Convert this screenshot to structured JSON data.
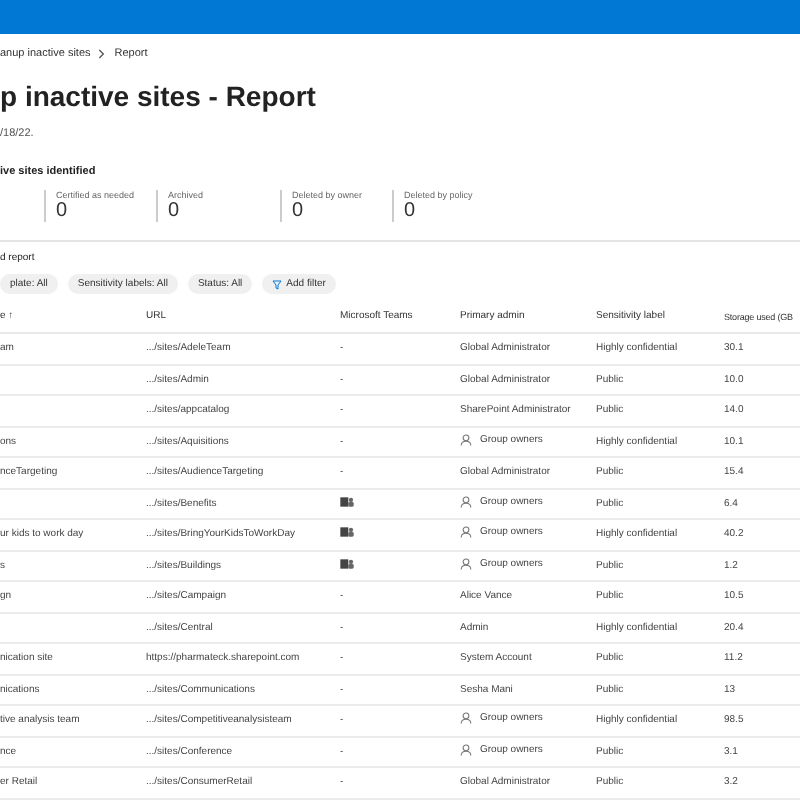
{
  "breadcrumb": [
    "anup inactive sites",
    "Report"
  ],
  "title": "p inactive sites - Report",
  "date": "/18/22.",
  "summary": {
    "heading": "ive sites identified",
    "stats": [
      {
        "label": "Certified as needed",
        "value": "0"
      },
      {
        "label": "Archived",
        "value": "0"
      },
      {
        "label": "Deleted by owner",
        "value": "0"
      },
      {
        "label": "Deleted by policy",
        "value": "0"
      }
    ]
  },
  "section_title": "d report",
  "filters": [
    {
      "label": "plate: All",
      "kind": "pill"
    },
    {
      "label": "Sensitivity labels: All",
      "kind": "pill"
    },
    {
      "label": "Status: All",
      "kind": "pill"
    },
    {
      "label": "Add filter",
      "kind": "add"
    }
  ],
  "table": {
    "columns": [
      "e ↑",
      "URL",
      "Microsoft Teams",
      "Primary admin",
      "Sensitivity label",
      "Storage used (GB"
    ],
    "rows": [
      {
        "name": "am",
        "url": ".../sites/AdeleTeam",
        "teams": false,
        "teams_text": "-",
        "admin": "Global Administrator",
        "group": false,
        "label": "Highly confidential",
        "storage": "30.1"
      },
      {
        "name": "",
        "url": ".../sites/Admin",
        "teams": false,
        "teams_text": "-",
        "admin": "Global Administrator",
        "group": false,
        "label": "Public",
        "storage": "10.0"
      },
      {
        "name": "",
        "url": ".../sites/appcatalog",
        "teams": false,
        "teams_text": "-",
        "admin": "SharePoint Administrator",
        "group": false,
        "label": "Public",
        "storage": "14.0"
      },
      {
        "name": "ons",
        "url": ".../sites/Aquisitions",
        "teams": false,
        "teams_text": "-",
        "admin": "Group owners",
        "group": true,
        "label": "Highly confidential",
        "storage": "10.1"
      },
      {
        "name": "nceTargeting",
        "url": ".../sites/AudienceTargeting",
        "teams": false,
        "teams_text": "-",
        "admin": "Global Administrator",
        "group": false,
        "label": "Public",
        "storage": "15.4"
      },
      {
        "name": "",
        "url": ".../sites/Benefits",
        "teams": true,
        "admin": "Group owners",
        "group": true,
        "label": "Public",
        "storage": "6.4"
      },
      {
        "name": "ur kids to work day",
        "url": ".../sites/BringYourKidsToWorkDay",
        "teams": true,
        "admin": "Group owners",
        "group": true,
        "label": "Highly confidential",
        "storage": "40.2"
      },
      {
        "name": "s",
        "url": ".../sites/Buildings",
        "teams": true,
        "admin": "Group owners",
        "group": true,
        "label": "Public",
        "storage": "1.2"
      },
      {
        "name": "gn",
        "url": ".../sites/Campaign",
        "teams": false,
        "teams_text": "-",
        "admin": "Alice Vance",
        "group": false,
        "label": "Public",
        "storage": "10.5"
      },
      {
        "name": "",
        "url": ".../sites/Central",
        "teams": false,
        "teams_text": "-",
        "admin": "Admin",
        "group": false,
        "label": "Highly confidential",
        "storage": "20.4"
      },
      {
        "name": "nication site",
        "url": "https://pharmateck.sharepoint.com",
        "teams": false,
        "teams_text": "-",
        "admin": "System Account",
        "group": false,
        "label": "Public",
        "storage": "11.2"
      },
      {
        "name": "nications",
        "url": ".../sites/Communications",
        "teams": false,
        "teams_text": "-",
        "admin": "Sesha Mani",
        "group": false,
        "label": "Public",
        "storage": "13"
      },
      {
        "name": "tive analysis team",
        "url": ".../sites/Competitiveanalysisteam",
        "teams": false,
        "teams_text": "-",
        "admin": "Group owners",
        "group": true,
        "label": "Highly confidential",
        "storage": "98.5"
      },
      {
        "name": "nce",
        "url": ".../sites/Conference",
        "teams": false,
        "teams_text": "-",
        "admin": "Group owners",
        "group": true,
        "label": "Public",
        "storage": "3.1"
      },
      {
        "name": "er Retail",
        "url": ".../sites/ConsumerRetail",
        "teams": false,
        "teams_text": "-",
        "admin": "Global Administrator",
        "group": false,
        "label": "Public",
        "storage": "3.2"
      }
    ]
  }
}
